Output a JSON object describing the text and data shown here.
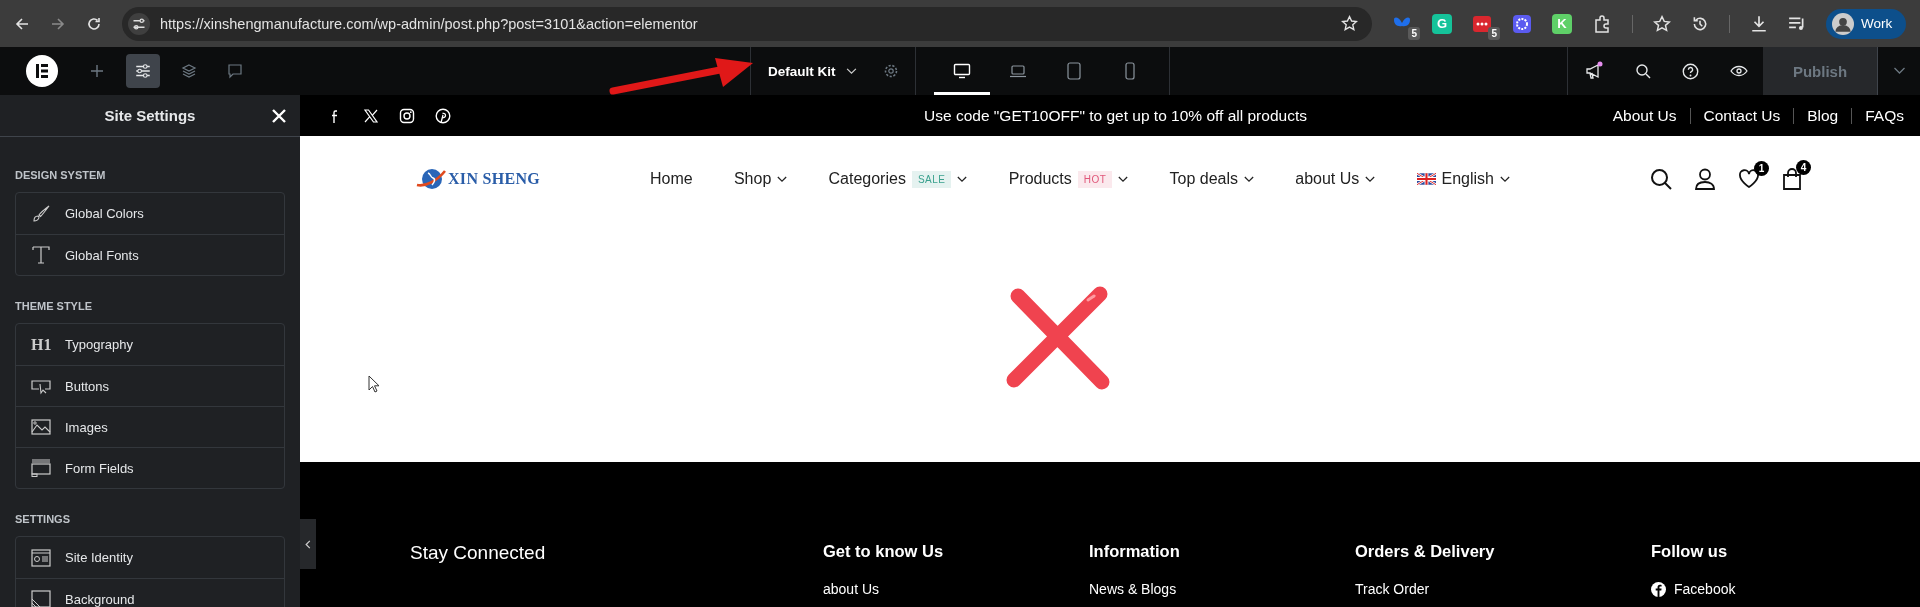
{
  "browser": {
    "url": "https://xinshengmanufacture.com/wp-admin/post.php?post=3101&action=elementor",
    "extensions": [
      {
        "kind": "butterfly",
        "badge": "5"
      },
      {
        "kind": "letter",
        "label": "G",
        "color": "#15c39a"
      },
      {
        "kind": "dots",
        "badge": "5"
      },
      {
        "kind": "flower"
      },
      {
        "kind": "letter",
        "label": "K",
        "color": "#5fd068"
      },
      {
        "kind": "puzzle"
      }
    ],
    "profile": "Work"
  },
  "editor_toolbar": {
    "tools": [
      {
        "kind": "add",
        "selected": false
      },
      {
        "kind": "settings",
        "selected": true
      },
      {
        "kind": "layers",
        "selected": false
      },
      {
        "kind": "comments",
        "selected": false
      }
    ],
    "kit": "Default Kit",
    "devices": [
      {
        "kind": "desktop",
        "selected": true
      },
      {
        "kind": "laptop",
        "selected": false
      },
      {
        "kind": "tablet",
        "selected": false
      },
      {
        "kind": "mobile",
        "selected": false
      }
    ],
    "publish": "Publish"
  },
  "sidebar": {
    "title": "Site Settings",
    "sections": [
      {
        "heading": "DESIGN SYSTEM",
        "items": [
          {
            "kind": "brush",
            "label": "Global Colors"
          },
          {
            "kind": "font",
            "label": "Global Fonts"
          }
        ]
      },
      {
        "heading": "THEME STYLE",
        "items": [
          {
            "kind": "h1",
            "label": "Typography",
            "glyph": "H1"
          },
          {
            "kind": "button",
            "label": "Buttons"
          },
          {
            "kind": "image",
            "label": "Images"
          },
          {
            "kind": "form",
            "label": "Form Fields"
          }
        ]
      },
      {
        "heading": "SETTINGS",
        "items": [
          {
            "kind": "identity",
            "label": "Site Identity"
          },
          {
            "kind": "background",
            "label": "Background"
          }
        ]
      }
    ]
  },
  "site": {
    "promo": "Use code \"GET10OFF\" to get up to 10% off all products",
    "top_links": [
      "About Us",
      "Contact Us",
      "Blog",
      "FAQs"
    ],
    "logo": "XIN SHENG",
    "nav": [
      {
        "kind": "link",
        "label": "Home"
      },
      {
        "kind": "menu",
        "label": "Shop"
      },
      {
        "kind": "menu",
        "label": "Categories",
        "tag": "SALE",
        "color": "#3aa18e"
      },
      {
        "kind": "menu",
        "label": "Products",
        "tag": "HOT",
        "color": "#e0577a"
      },
      {
        "kind": "menu",
        "label": "Top deals"
      },
      {
        "kind": "menu",
        "label": "about Us"
      },
      {
        "kind": "language",
        "label": "English"
      }
    ],
    "wishlist_count": "1",
    "cart_count": "4"
  },
  "footer": {
    "columns": [
      {
        "heading": "Stay Connected"
      },
      {
        "heading": "Get to know Us",
        "links": [
          "about Us"
        ]
      },
      {
        "heading": "Information",
        "links": [
          "News & Blogs"
        ]
      },
      {
        "heading": "Orders & Delivery",
        "links": [
          "Track Order"
        ]
      },
      {
        "heading": "Follow us",
        "links": [
          "Facebook"
        ],
        "kind": "social"
      }
    ]
  }
}
